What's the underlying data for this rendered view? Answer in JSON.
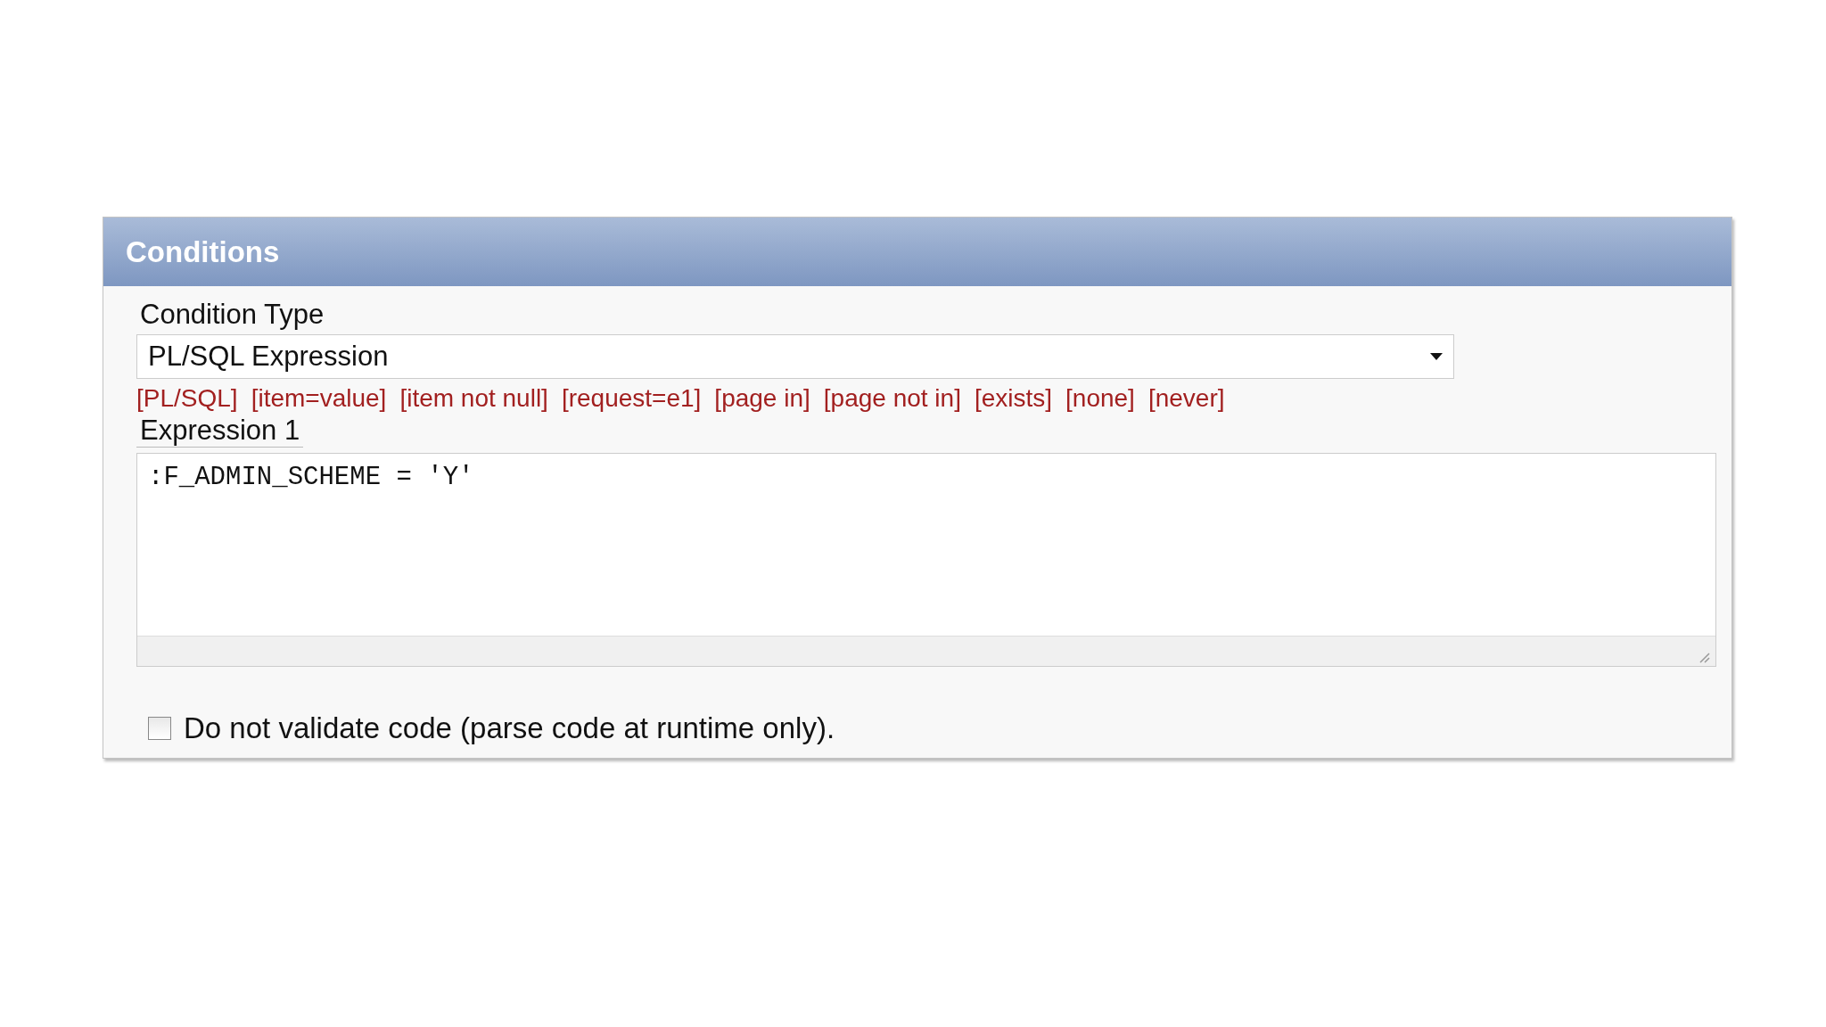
{
  "panel": {
    "title": "Conditions"
  },
  "condition_type": {
    "label": "Condition Type",
    "value": "PL/SQL Expression"
  },
  "shortcuts": [
    {
      "label": "[PL/SQL]"
    },
    {
      "label": "[item=value]"
    },
    {
      "label": "[item not null]"
    },
    {
      "label": "[request=e1]"
    },
    {
      "label": "[page in]"
    },
    {
      "label": "[page not in]"
    },
    {
      "label": "[exists]"
    },
    {
      "label": "[none]"
    },
    {
      "label": "[never]"
    }
  ],
  "expression_1": {
    "label": "Expression 1",
    "value": ":F_ADMIN_SCHEME = 'Y'"
  },
  "validate_option": {
    "label": "Do not validate code (parse code at runtime only).",
    "checked": false
  }
}
